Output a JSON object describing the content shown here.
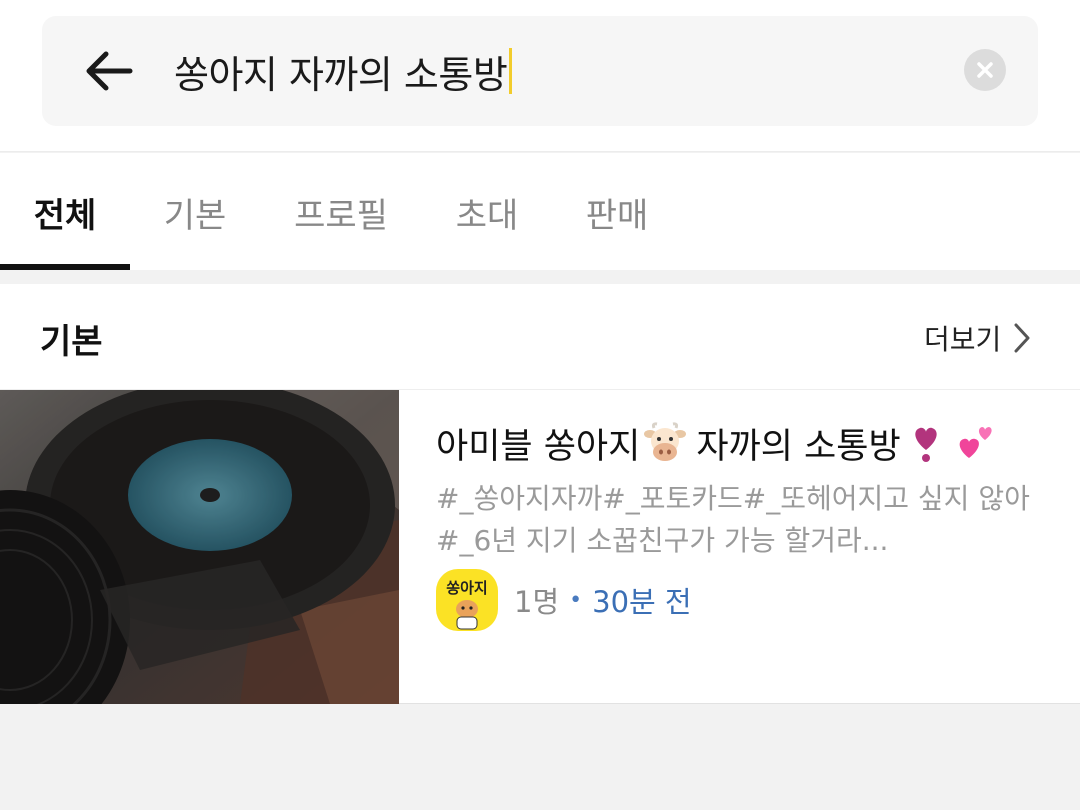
{
  "search": {
    "query": "쏭아지 자까의 소통방",
    "back_icon": "back-arrow-icon",
    "clear_icon": "clear-icon"
  },
  "tabs": [
    {
      "label": "전체",
      "active": true
    },
    {
      "label": "기본",
      "active": false
    },
    {
      "label": "프로필",
      "active": false
    },
    {
      "label": "초대",
      "active": false
    },
    {
      "label": "판매",
      "active": false
    }
  ],
  "section": {
    "title": "기본",
    "more_label": "더보기"
  },
  "result": {
    "title_part1": "아미블 쏭아지",
    "title_part2": "자까의 소통방",
    "emoji_cow": "cow-face-emoji",
    "emoji_heart_exclamation": "heart-exclamation-emoji",
    "emoji_two_hearts": "two-hearts-emoji",
    "description": "#_쏭아지자까#_포토카드#_또헤어지고 싶지 않아#_6년 지기 소꿉친구가 가능 할거라...",
    "avatar_text": "쏭아지",
    "member_count": "1명",
    "separator": "•",
    "time_ago": "30분 전"
  },
  "colors": {
    "accent_caret": "#f2cc2c",
    "avatar_bg": "#fbe225",
    "time_text": "#3b6fb5"
  }
}
